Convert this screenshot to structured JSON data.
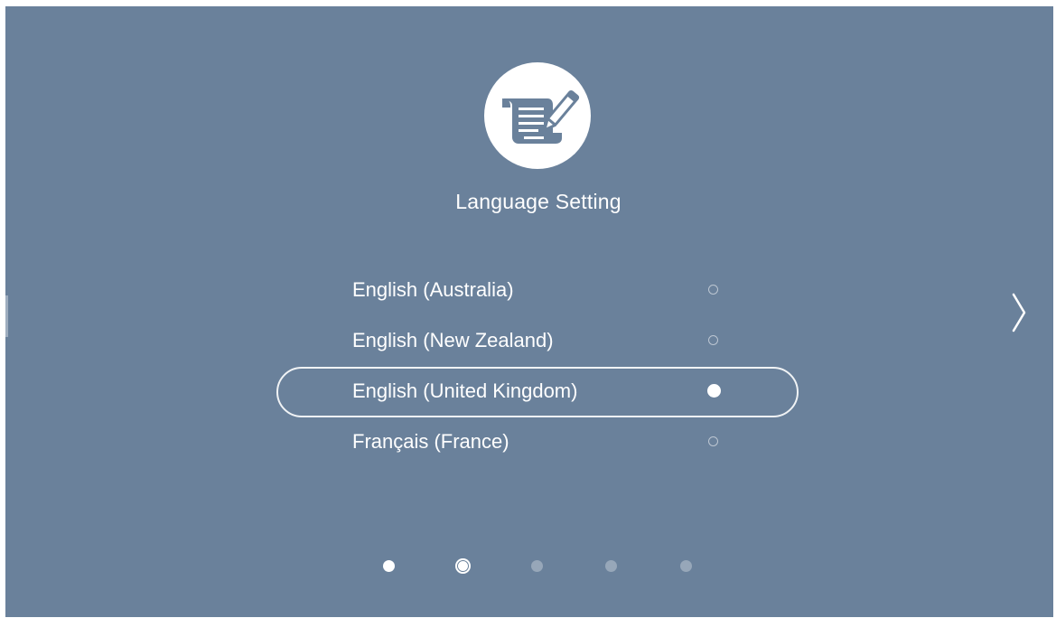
{
  "screen": {
    "title": "Language Setting",
    "icon": "document-pen-icon"
  },
  "languages": [
    {
      "label": "English (Australia)",
      "selected": false
    },
    {
      "label": "English (New Zealand)",
      "selected": false
    },
    {
      "label": "English (United Kingdom)",
      "selected": true
    },
    {
      "label": "Français (France)",
      "selected": false
    }
  ],
  "navigation": {
    "next_icon": "chevron-right-icon",
    "page_count": 5,
    "current_page": 2
  },
  "colors": {
    "background": "#6a819b",
    "foreground": "#ffffff"
  }
}
